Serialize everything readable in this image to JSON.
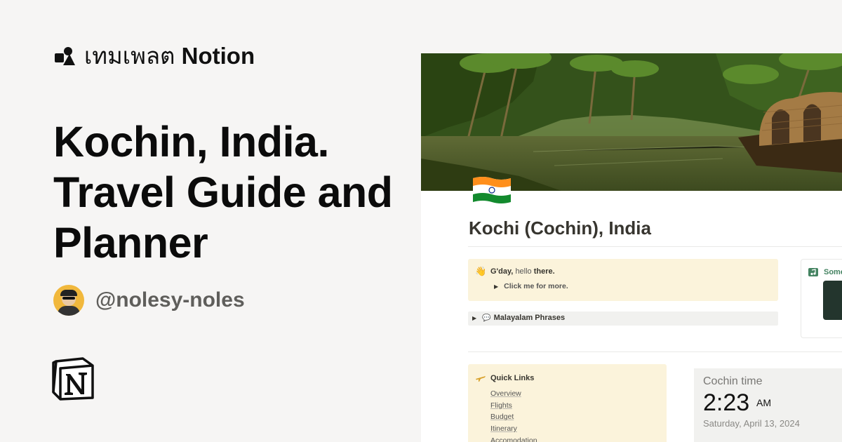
{
  "brand": {
    "thai": "เทมเพลต",
    "name": "Notion"
  },
  "title": "Kochin, India. Travel Guide and Planner",
  "author": {
    "handle": "@nolesy-noles"
  },
  "page": {
    "icon": "india-flag-icon",
    "title": "Kochi (Cochin), India",
    "callout": {
      "emoji": "👋",
      "greeting_bold": "G'day,",
      "greeting_light": "hello",
      "greeting_end": "there.",
      "toggle": "Click me for more."
    },
    "phrases_toggle": "Malayalam Phrases",
    "music_label": "Some",
    "quick_links": {
      "title": "Quick Links",
      "items": [
        "Overview",
        "Flights",
        "Budget",
        "Itinerary",
        "Accomodation"
      ]
    },
    "clock": {
      "label": "Cochin time",
      "time": "2:23",
      "ampm": "AM",
      "date": "Saturday, April 13, 2024"
    }
  },
  "colors": {
    "background": "#f6f5f4",
    "callout": "#fbf3db",
    "green_accent": "#448361"
  }
}
